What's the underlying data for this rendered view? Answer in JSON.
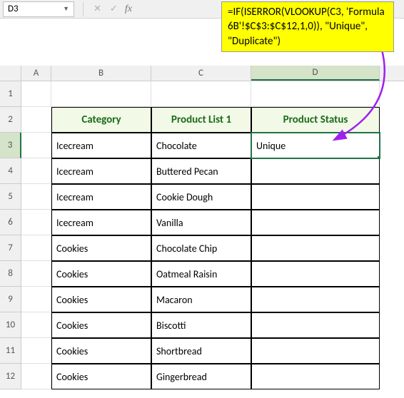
{
  "nameBox": {
    "value": "D3"
  },
  "formulaCallout": "=IF(ISERROR(VLOOKUP(C3, 'Formula 6B'!$C$3:$C$12,1,0)), \"Unique\", \"Duplicate\")",
  "columns": {
    "A": "A",
    "B": "B",
    "C": "C",
    "D": "D"
  },
  "headers": {
    "B": "Category",
    "C": "Product List 1",
    "D": "Product Status"
  },
  "rows": [
    {
      "n": "1",
      "B": "",
      "C": "",
      "D": ""
    },
    {
      "n": "2",
      "B": "Category",
      "C": "Product List 1",
      "D": "Product Status",
      "isHeader": true
    },
    {
      "n": "3",
      "B": "Icecream",
      "C": "Chocolate",
      "D": "Unique",
      "selected": true
    },
    {
      "n": "4",
      "B": "Icecream",
      "C": "Buttered Pecan",
      "D": ""
    },
    {
      "n": "5",
      "B": "Icecream",
      "C": "Cookie Dough",
      "D": ""
    },
    {
      "n": "6",
      "B": "Icecream",
      "C": "Vanilla",
      "D": ""
    },
    {
      "n": "7",
      "B": "Cookies",
      "C": "Chocolate Chip",
      "D": ""
    },
    {
      "n": "8",
      "B": "Cookies",
      "C": "Oatmeal Raisin",
      "D": ""
    },
    {
      "n": "9",
      "B": "Cookies",
      "C": "Macaron",
      "D": ""
    },
    {
      "n": "10",
      "B": "Cookies",
      "C": "Biscotti",
      "D": ""
    },
    {
      "n": "11",
      "B": "Cookies",
      "C": "Shortbread",
      "D": ""
    },
    {
      "n": "12",
      "B": "Cookies",
      "C": "Gingerbread",
      "D": ""
    }
  ],
  "activeRow": "3",
  "activeCol": "D"
}
